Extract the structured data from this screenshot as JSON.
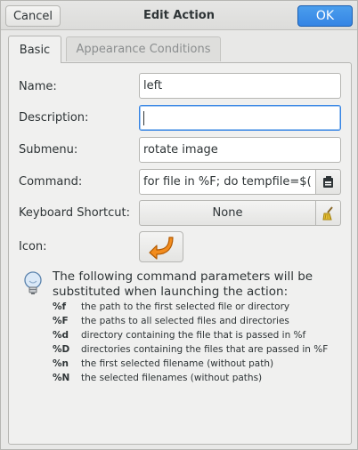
{
  "header": {
    "title": "Edit Action",
    "cancel_label": "Cancel",
    "ok_label": "OK"
  },
  "tabs": [
    {
      "label": "Basic",
      "active": true
    },
    {
      "label": "Appearance Conditions",
      "active": false
    }
  ],
  "form": {
    "name_label": "Name:",
    "name_value": "left",
    "description_label": "Description:",
    "description_value": "",
    "submenu_label": "Submenu:",
    "submenu_value": "rotate image",
    "command_label": "Command:",
    "command_value": "for file in %F; do tempfile=$(",
    "shortcut_label": "Keyboard Shortcut:",
    "shortcut_value": "None",
    "icon_label": "Icon:",
    "icon_name": "curved-arrow-left-icon"
  },
  "info": {
    "intro": "The following command parameters will be substituted when launching the action:",
    "params": [
      {
        "key": "%f",
        "desc": "the path to the first selected file or directory"
      },
      {
        "key": "%F",
        "desc": "the paths to all selected files and directories"
      },
      {
        "key": "%d",
        "desc": "directory containing the file that is passed in %f"
      },
      {
        "key": "%D",
        "desc": "directories containing the files that are passed in %F"
      },
      {
        "key": "%n",
        "desc": "the first selected filename (without path)"
      },
      {
        "key": "%N",
        "desc": "the selected filenames (without paths)"
      }
    ]
  },
  "colors": {
    "accent": "#3584e4",
    "background": "#e8e8e7",
    "icon_orange": "#f28c1e"
  }
}
